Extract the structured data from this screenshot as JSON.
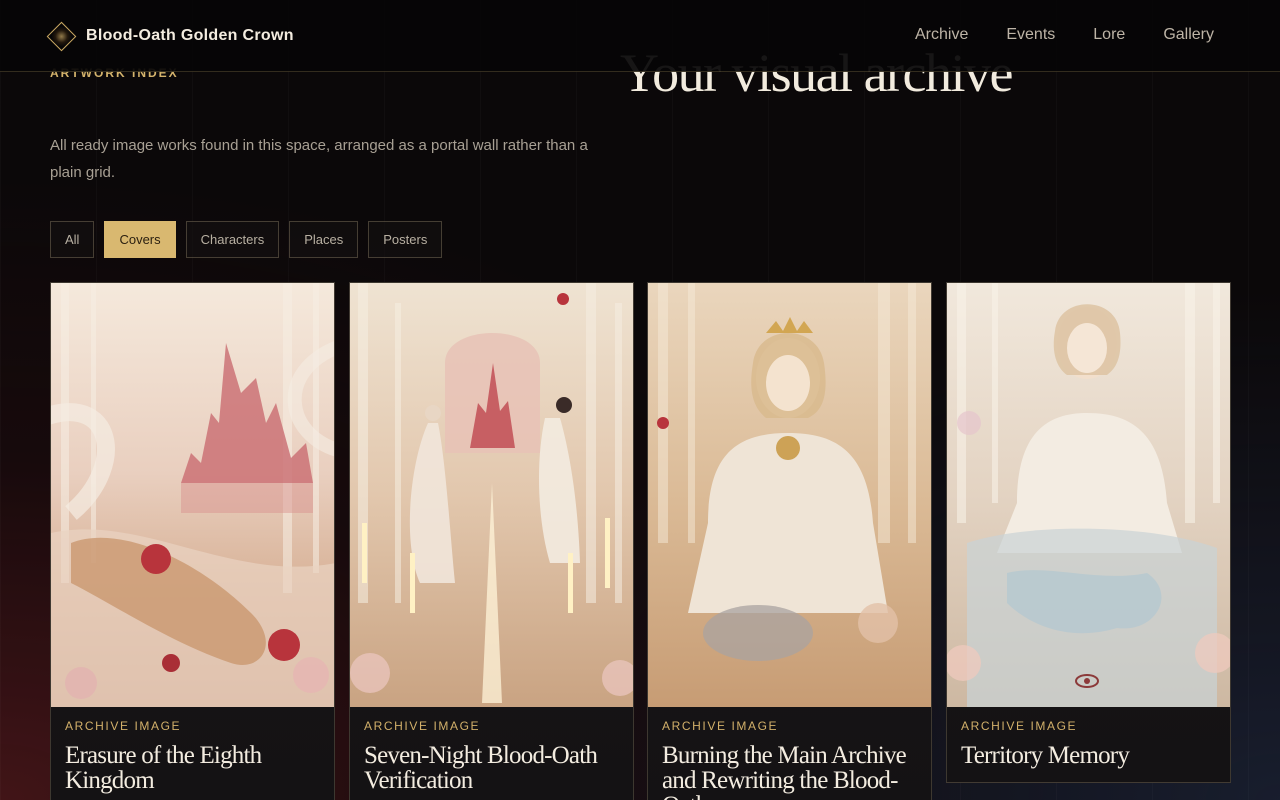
{
  "header": {
    "brand_name": "Blood-Oath Golden Crown",
    "nav": [
      "Archive",
      "Events",
      "Lore",
      "Gallery"
    ]
  },
  "hero": {
    "eyebrow": "Artwork Index",
    "title": "Your visual archive",
    "description": "All ready image works found in this space, arranged as a portal wall rather than a plain grid."
  },
  "filters": {
    "items": [
      "All",
      "Covers",
      "Characters",
      "Places",
      "Posters"
    ],
    "active": "Covers"
  },
  "cards": [
    {
      "kind": "Archive Image",
      "title": "Erasure of the Eighth Kingdom"
    },
    {
      "kind": "Archive Image",
      "title": "Seven-Night Blood-Oath Verification"
    },
    {
      "kind": "Archive Image",
      "title": "Burning the Main Archive and Rewriting the Blood-Oath"
    },
    {
      "kind": "Archive Image",
      "title": "Territory Memory"
    }
  ],
  "colors": {
    "accent": "#d9b870",
    "background": "#0b0809",
    "crimson": "#b8343c"
  }
}
